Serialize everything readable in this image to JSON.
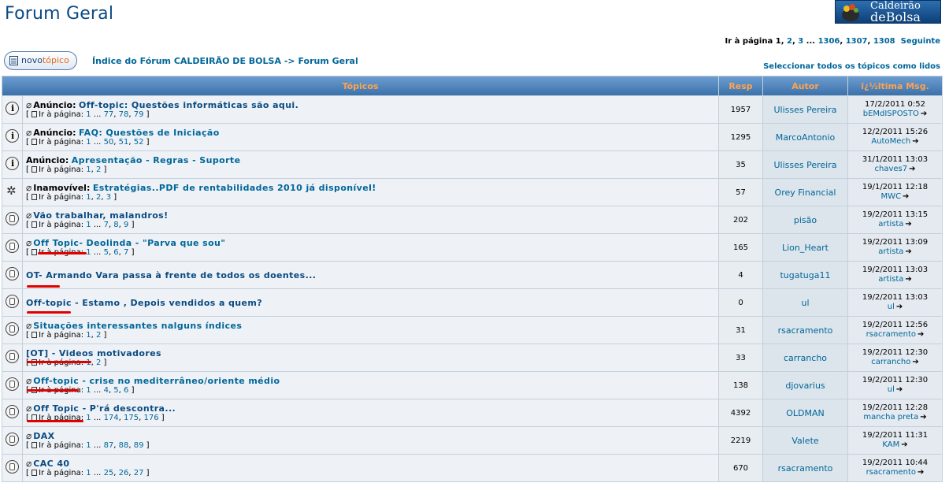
{
  "page_title": "Forum Geral",
  "logo": {
    "line1": "Caldeirão",
    "line2": "deBolsa"
  },
  "pagination": {
    "label": "Ir à página",
    "p1": "1",
    "p2": "2",
    "p3": "3",
    "ellipsis": "...",
    "p4": "1306",
    "p5": "1307",
    "p6": "1308",
    "next": "Seguinte"
  },
  "new_topic": {
    "part1": "novo",
    "part2": "tópico"
  },
  "breadcrumb": {
    "index": "Índice do Fórum CALDEIRÃO DE BOLSA",
    "sep": "->",
    "current": "Forum Geral"
  },
  "mark_read": "Seleccionar todos os tópicos como lidos",
  "headers": {
    "topics": "Tópicos",
    "resp": "Resp",
    "autor": "Autor",
    "last": "ï¿½ltima Msg."
  },
  "goto_label": "Ir à página:",
  "topics": [
    {
      "type": "ann",
      "clip": true,
      "label": "Anúncio:",
      "title": "Off-topic: Questões informáticas são aqui.",
      "hot": true,
      "pages": [
        "1",
        "...",
        "77",
        "78",
        "79"
      ],
      "resp": "1957",
      "author": "Ulisses Pereira",
      "last_date": "17/2/2011 0:52",
      "last_user": "bEMdISPOSTO"
    },
    {
      "type": "ann",
      "clip": true,
      "label": "Anúncio:",
      "title": "FAQ: Questões de Iniciação",
      "hot": false,
      "pages": [
        "1",
        "...",
        "50",
        "51",
        "52"
      ],
      "resp": "1295",
      "author": "MarcoAntonio",
      "last_date": "12/2/2011 15:26",
      "last_user": "AutoMech"
    },
    {
      "type": "ann",
      "clip": false,
      "label": "Anúncio:",
      "title": "Apresentação - Regras - Suporte",
      "hot": false,
      "pages": [
        "1",
        "2"
      ],
      "resp": "35",
      "author": "Ulisses Pereira",
      "last_date": "31/1/2011 13:03",
      "last_user": "chaves7"
    },
    {
      "type": "sticky",
      "clip": true,
      "label": "Inamovível:",
      "title": "Estratégias..PDF de rentabilidades 2010 já disponível!",
      "hot": false,
      "pages": [
        "1",
        "2",
        "3"
      ],
      "resp": "57",
      "author": "Orey Financial",
      "last_date": "19/1/2011 12:18",
      "last_user": "MWC"
    },
    {
      "type": "hot",
      "clip": true,
      "label": "",
      "title": "Vão trabalhar, malandros!",
      "hot": true,
      "pages": [
        "1",
        "...",
        "7",
        "8",
        "9"
      ],
      "resp": "202",
      "author": "pisão",
      "last_date": "19/2/2011 13:15",
      "last_user": "artista"
    },
    {
      "type": "hot",
      "clip": true,
      "label": "",
      "title": "Off Topic- Deolinda - \"Parva que sou\"",
      "hot": false,
      "pages": [
        "1",
        "...",
        "5",
        "6",
        "7"
      ],
      "resp": "165",
      "author": "Lion_Heart",
      "last_date": "19/2/2011 13:09",
      "last_user": "artista"
    },
    {
      "type": "normal",
      "clip": false,
      "label": "",
      "title": "OT- Armando Vara passa à frente de todos os doentes...",
      "hot": true,
      "pages": [],
      "resp": "4",
      "author": "tugatuga11",
      "last_date": "19/2/2011 13:03",
      "last_user": "artista"
    },
    {
      "type": "normal",
      "clip": false,
      "label": "",
      "title": "Off-topic - Estamo , Depois vendidos a quem?",
      "hot": true,
      "pages": [],
      "resp": "0",
      "author": "ul",
      "last_date": "19/2/2011 13:03",
      "last_user": "ul"
    },
    {
      "type": "normal",
      "clip": true,
      "label": "",
      "title": "Situações interessantes nalguns índices",
      "hot": false,
      "pages": [
        "1",
        "2"
      ],
      "resp": "31",
      "author": "rsacramento",
      "last_date": "19/2/2011 12:56",
      "last_user": "rsacramento"
    },
    {
      "type": "normal",
      "clip": false,
      "label": "",
      "title": "[OT] - Videos motivadores",
      "hot": true,
      "pages": [
        "1",
        "2"
      ],
      "resp": "33",
      "author": "carrancho",
      "last_date": "19/2/2011 12:30",
      "last_user": "carrancho"
    },
    {
      "type": "hot",
      "clip": true,
      "label": "",
      "title": "Off-topic - crise no mediterrâneo/oriente médio",
      "hot": false,
      "pages": [
        "1",
        "...",
        "4",
        "5",
        "6"
      ],
      "resp": "138",
      "author": "djovarius",
      "last_date": "19/2/2011 12:30",
      "last_user": "ul"
    },
    {
      "type": "hot",
      "clip": true,
      "label": "",
      "title": "Off Topic - P'rá descontra...",
      "hot": true,
      "pages": [
        "1",
        "...",
        "174",
        "175",
        "176"
      ],
      "resp": "4392",
      "author": "OLDMAN",
      "last_date": "19/2/2011 12:28",
      "last_user": "mancha preta"
    },
    {
      "type": "hot",
      "clip": true,
      "label": "",
      "title": "DAX",
      "hot": true,
      "pages": [
        "1",
        "...",
        "87",
        "88",
        "89"
      ],
      "resp": "2219",
      "author": "Valete",
      "last_date": "19/2/2011 11:31",
      "last_user": "KAM"
    },
    {
      "type": "hot",
      "clip": true,
      "label": "",
      "title": "CAC 40",
      "hot": true,
      "pages": [
        "1",
        "...",
        "25",
        "26",
        "27"
      ],
      "resp": "670",
      "author": "rsacramento",
      "last_date": "19/2/2011 10:44",
      "last_user": "rsacramento"
    }
  ],
  "colors": {
    "link": "#006699",
    "header_text": "#ffa34f",
    "annotation": "#e00000"
  }
}
